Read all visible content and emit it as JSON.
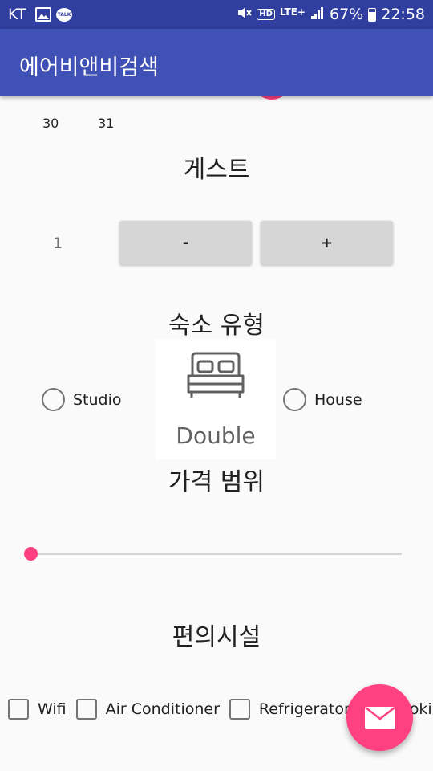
{
  "status_bar": {
    "carrier": "KT",
    "talk_label": "TALK",
    "network": "HD",
    "lte": "LTE+",
    "battery": "67%",
    "time": "22:58"
  },
  "app_bar": {
    "title": "에어비앤비검색"
  },
  "calendar": {
    "days": [
      "30",
      "31"
    ]
  },
  "guests": {
    "title": "게스트",
    "count": "1",
    "minus_label": "-",
    "plus_label": "+"
  },
  "room_type": {
    "title": "숙소 유형",
    "options": {
      "studio": "Studio",
      "double": "Double",
      "house": "House"
    }
  },
  "price": {
    "title": "가격 범위",
    "slider_value": 0
  },
  "amenities": {
    "title": "편의시설",
    "items": [
      "Wifi",
      "Air Conditioner",
      "Refrigerator",
      "Cooking"
    ]
  },
  "icons": {
    "fab": "mail-icon",
    "double": "bed-icon"
  },
  "colors": {
    "primary": "#3f51b5",
    "primary_dark": "#303f9f",
    "accent": "#ff4081"
  }
}
